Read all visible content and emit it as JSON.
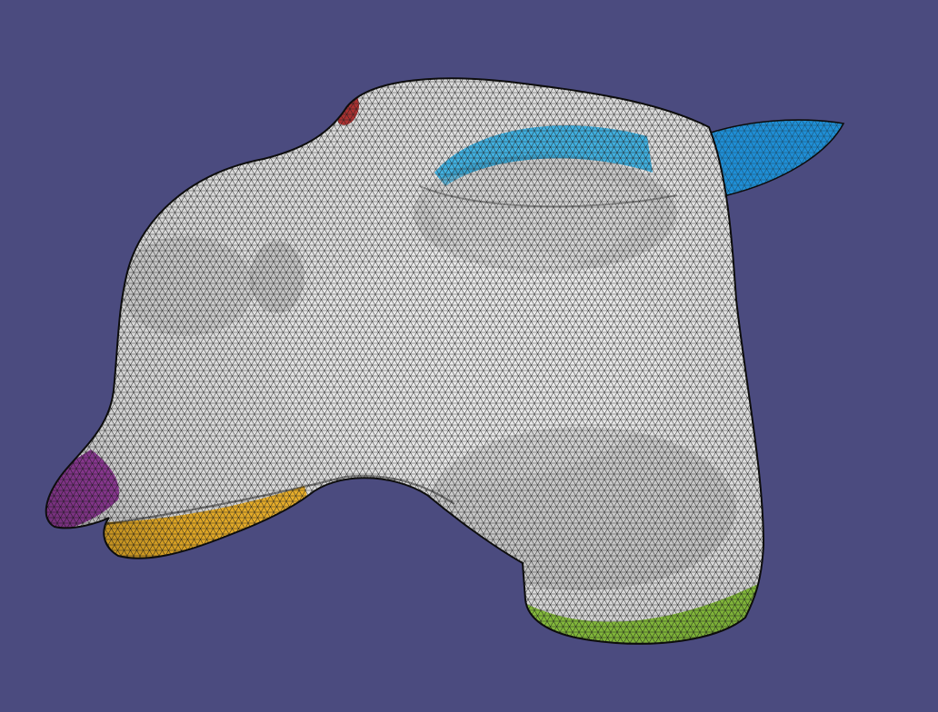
{
  "viewport": {
    "background_color": "#4b4b7f"
  },
  "mesh": {
    "surface_color": "#e6e6e6",
    "wire_color": "#1a1a1a",
    "outline_color": "#0d0d0d"
  },
  "regions": [
    {
      "id": "ear",
      "color": "#1f8fd6"
    },
    {
      "id": "eyebrow",
      "color": "#3fb4e6"
    },
    {
      "id": "nose-tip",
      "color": "#9b3fa3"
    },
    {
      "id": "lower-lip",
      "color": "#f2b52a"
    },
    {
      "id": "neck-base",
      "color": "#8cc63f"
    },
    {
      "id": "back-spot",
      "color": "#b03030"
    }
  ]
}
